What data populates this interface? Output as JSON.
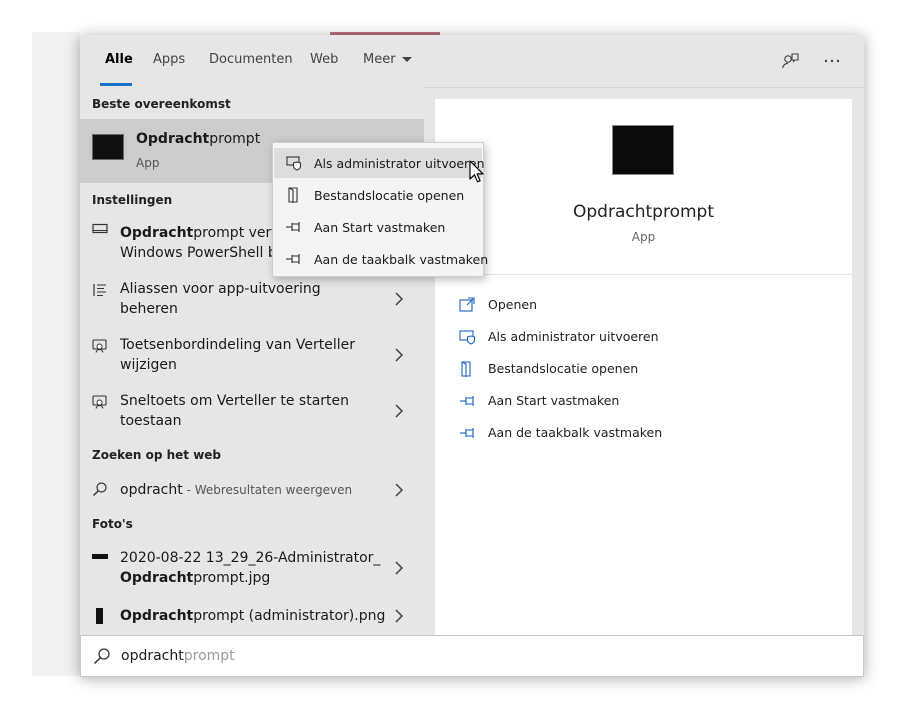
{
  "tabs": [
    {
      "label": "Alle",
      "active": true
    },
    {
      "label": "Apps",
      "active": false
    },
    {
      "label": "Documenten",
      "active": false
    },
    {
      "label": "Web",
      "active": false
    },
    {
      "label": "Meer",
      "active": false
    }
  ],
  "header_icons": [
    "feedback-icon",
    "more-options-icon"
  ],
  "sections": {
    "best_match": "Beste overeenkomst",
    "settings": "Instellingen",
    "web": "Zoeken op het web",
    "photos": "Foto's"
  },
  "best_match": {
    "title_bold": "Opdracht",
    "title_rest": "prompt",
    "subtitle": "App",
    "icon": "cmd-app-icon"
  },
  "settings_items": [
    {
      "bold": "Opdracht",
      "line1_rest": "prompt verva",
      "line2": "Windows PowerShell bi",
      "icon": "display-icon"
    },
    {
      "line1": "Aliassen voor app-uitvoering",
      "line2": "beheren",
      "icon": "list-icon"
    },
    {
      "line1": "Toetsenbordindeling van Verteller",
      "line2": "wijzigen",
      "icon": "narrator-icon"
    },
    {
      "line1": "Sneltoets om Verteller te starten",
      "line2": "toestaan",
      "icon": "narrator-icon"
    }
  ],
  "web_item": {
    "query": "opdracht",
    "suffix": " - Webresultaten weergeven",
    "icon": "search-icon"
  },
  "photo_items": [
    {
      "line1": "2020-08-22 13_29_26-Administrator_",
      "line2_bold": "Opdracht",
      "line2_rest": "prompt.jpg",
      "icon": "image-icon"
    },
    {
      "bold": "Opdracht",
      "rest": "prompt (administrator).png",
      "icon": "image-icon"
    }
  ],
  "preview": {
    "title": "Opdrachtprompt",
    "subtitle": "App",
    "actions": [
      {
        "label": "Openen",
        "icon": "open-icon"
      },
      {
        "label": "Als administrator uitvoeren",
        "icon": "admin-shield-icon"
      },
      {
        "label": "Bestandslocatie openen",
        "icon": "file-location-icon"
      },
      {
        "label": "Aan Start vastmaken",
        "icon": "pin-icon"
      },
      {
        "label": "Aan de taakbalk vastmaken",
        "icon": "pin-icon"
      }
    ]
  },
  "context_menu": [
    {
      "label": "Als administrator uitvoeren",
      "icon": "admin-shield-icon",
      "highlighted": true
    },
    {
      "label": "Bestandslocatie openen",
      "icon": "file-location-icon",
      "highlighted": false
    },
    {
      "label": "Aan Start vastmaken",
      "icon": "pin-icon",
      "highlighted": false
    },
    {
      "label": "Aan de taakbalk vastmaken",
      "icon": "pin-icon",
      "highlighted": false
    }
  ],
  "search": {
    "typed": "opdracht",
    "hint": "prompt",
    "icon": "search-icon"
  },
  "colors": {
    "accent": "#1a73c8",
    "icon_blue": "#1565c0",
    "panel": "#e6e6e6",
    "selected": "#cccccc"
  }
}
